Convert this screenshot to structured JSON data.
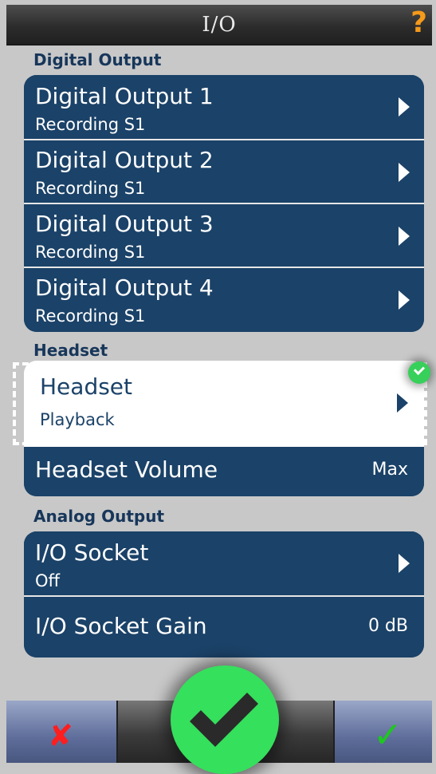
{
  "header": {
    "title": "I/O",
    "help_icon": "question-mark-icon"
  },
  "sections": [
    {
      "title": "Digital Output",
      "rows": [
        {
          "label": "Digital Output 1",
          "value": "Recording S1"
        },
        {
          "label": "Digital Output 2",
          "value": "Recording S1"
        },
        {
          "label": "Digital Output 3",
          "value": "Recording S1"
        },
        {
          "label": "Digital Output 4",
          "value": "Recording S1"
        }
      ]
    },
    {
      "title": "Headset",
      "selected": {
        "label": "Headset",
        "value": "Playback"
      },
      "rows": [
        {
          "label": "Headset Volume",
          "value": "Max"
        }
      ]
    },
    {
      "title": "Analog Output",
      "rows": [
        {
          "label": "I/O Socket",
          "value": "Off"
        },
        {
          "label": "I/O Socket Gain",
          "value": "0 dB"
        }
      ]
    }
  ],
  "toolbar": {
    "cancel_icon": "x-icon",
    "confirm_icon": "check-icon",
    "center_icon": "big-check-icon"
  },
  "colors": {
    "card": "#1b4268",
    "help": "#f59a1b",
    "confirm_green": "#35e05c",
    "cancel_red": "#ff1e1e"
  }
}
